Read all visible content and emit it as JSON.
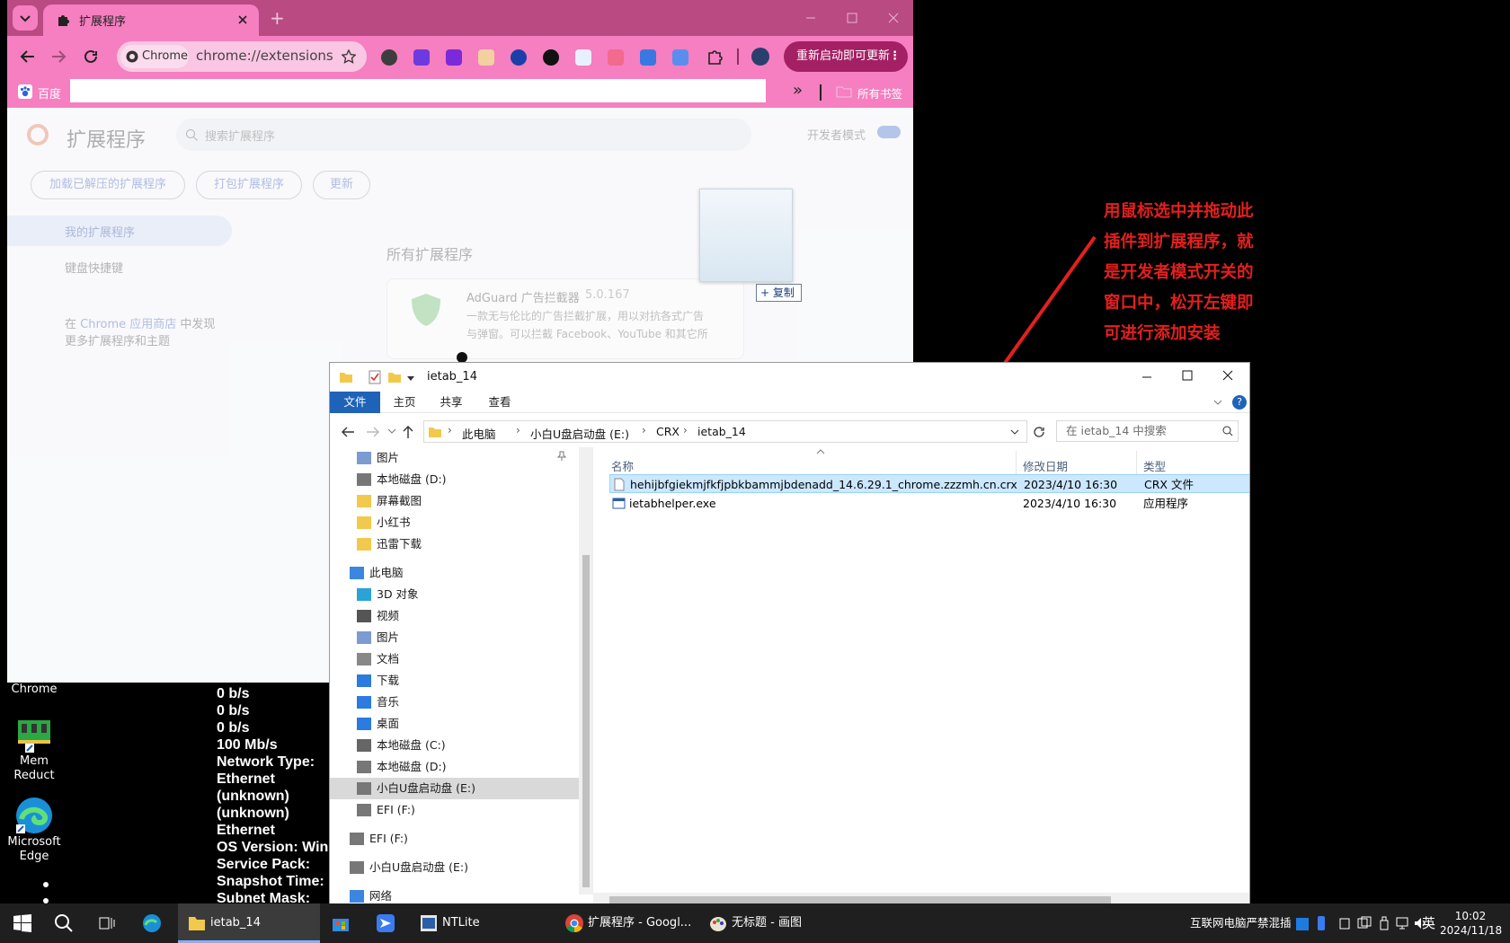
{
  "chrome": {
    "tab_title": "扩展程序",
    "new_tab_symbol": "+",
    "omnibox_chip": "Chrome",
    "url": "chrome://extensions",
    "update_button": "重新启动即可更新",
    "bookmark_baidu": "百度",
    "bookmarks_all": "所有书签",
    "bookmarks_more": "»",
    "page": {
      "title": "扩展程序",
      "search_placeholder": "搜索扩展程序",
      "dev_mode": "开发者模式",
      "load_unpacked": "加载已解压的扩展程序",
      "pack": "打包扩展程序",
      "update": "更新",
      "nav_my_extensions": "我的扩展程序",
      "nav_shortcuts": "键盘快捷键",
      "store_prefix": "在",
      "store_link": "Chrome 应用商店",
      "store_suffix": "中发现",
      "store_line2": "更多扩展程序和主题",
      "all_extensions": "所有扩展程序",
      "ext_name": "AdGuard 广告拦截器",
      "ext_version": "5.0.167",
      "ext_desc1": "一款无与伦比的广告拦截扩展，用以对抗各式广告",
      "ext_desc2": "与弹窗。可以拦截 Facebook、YouTube 和其它所"
    },
    "copy_tooltip": "+ 复制"
  },
  "desktop": {
    "icons": [
      {
        "label": "Chrome"
      },
      {
        "label": "Mem\nReduct"
      },
      {
        "label": "Microsoft\nEdge"
      }
    ],
    "bginfo": [
      "0 b/s",
      "0 b/s",
      "0 b/s",
      "100 Mb/s",
      "Network Type:",
      "Ethernet",
      "(unknown)",
      "(unknown)",
      "Ethernet",
      "OS Version: Win",
      "Service Pack:",
      "Snapshot Time:",
      "Subnet Mask:"
    ]
  },
  "explorer": {
    "title": "ietab_14",
    "ribbon": [
      "文件",
      "主页",
      "共享",
      "查看"
    ],
    "breadcrumb": [
      "此电脑",
      "小白U盘启动盘 (E:)",
      "CRX",
      "ietab_14"
    ],
    "search_placeholder": "在 ietab_14 中搜索",
    "nav": [
      {
        "label": "图片",
        "indent": 1
      },
      {
        "label": "本地磁盘 (D:)",
        "indent": 1
      },
      {
        "label": "屏幕截图",
        "indent": 1
      },
      {
        "label": "小红书",
        "indent": 1
      },
      {
        "label": "迅雷下载",
        "indent": 1
      },
      {
        "label": "此电脑",
        "indent": 0
      },
      {
        "label": "3D 对象",
        "indent": 1
      },
      {
        "label": "视频",
        "indent": 1
      },
      {
        "label": "图片",
        "indent": 1
      },
      {
        "label": "文档",
        "indent": 1
      },
      {
        "label": "下载",
        "indent": 1
      },
      {
        "label": "音乐",
        "indent": 1
      },
      {
        "label": "桌面",
        "indent": 1
      },
      {
        "label": "本地磁盘 (C:)",
        "indent": 1
      },
      {
        "label": "本地磁盘 (D:)",
        "indent": 1
      },
      {
        "label": "小白U盘启动盘 (E:)",
        "indent": 1,
        "selected": true
      },
      {
        "label": "EFI (F:)",
        "indent": 1
      },
      {
        "label": "EFI (F:)",
        "indent": 0
      },
      {
        "label": "小白U盘启动盘 (E:)",
        "indent": 0
      },
      {
        "label": "网络",
        "indent": 0
      }
    ],
    "columns": {
      "name": "名称",
      "date": "修改日期",
      "type": "类型"
    },
    "files": [
      {
        "name": "hehijbfgiekmjfkfjpbkbammjbdenadd_14.6.29.1_chrome.zzzmh.cn.crx",
        "date": "2023/4/10 16:30",
        "type": "CRX 文件",
        "selected": true
      },
      {
        "name": "ietabhelper.exe",
        "date": "2023/4/10 16:30",
        "type": "应用程序"
      }
    ]
  },
  "annotation": "用鼠标选中并拖动此插件到扩展程序，就是开发者模式开关的窗口中，松开左键即可进行添加安装",
  "taskbar": {
    "items": [
      {
        "label": "ietab_14"
      },
      {
        "label": "NTLite"
      },
      {
        "label": "扩展程序 - Googl..."
      },
      {
        "label": "无标题 - 画图"
      }
    ],
    "tray_text": "互联网电脑严禁混插",
    "ime": "英",
    "time": "10:02",
    "date": "2024/11/18"
  },
  "colors": {
    "chrome_theme": "#f57fc0",
    "tab_strip": "#b94a82",
    "annotation": "#e41f1f",
    "taskbar": "#1f1f1f"
  }
}
